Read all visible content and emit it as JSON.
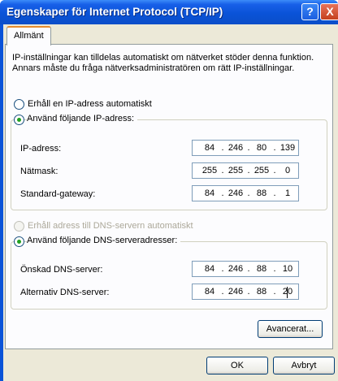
{
  "window": {
    "title": "Egenskaper för Internet Protocol (TCP/IP)",
    "help_glyph": "?",
    "close_glyph": "X"
  },
  "tab": {
    "label": "Allmänt"
  },
  "description": "IP-inställningar kan tilldelas automatiskt om nätverket stöder denna funktion. Annars måste du fråga nätverksadministratören om rätt IP-inställningar.",
  "ip_section": {
    "auto_option": "Erhåll en IP-adress automatiskt",
    "manual_option": "Använd följande IP-adress:",
    "selected": "manual",
    "fields": [
      {
        "label": "IP-adress:",
        "octets": [
          "84",
          "246",
          "80",
          "139"
        ]
      },
      {
        "label": "Nätmask:",
        "octets": [
          "255",
          "255",
          "255",
          "0"
        ]
      },
      {
        "label": "Standard-gateway:",
        "octets": [
          "84",
          "246",
          "88",
          "1"
        ]
      }
    ]
  },
  "dns_section": {
    "auto_option": "Erhåll adress till DNS-servern automatiskt",
    "auto_disabled": true,
    "manual_option": "Använd följande DNS-serveradresser:",
    "selected": "manual",
    "fields": [
      {
        "label": "Önskad DNS-server:",
        "octets": [
          "84",
          "246",
          "88",
          "10"
        ]
      },
      {
        "label": "Alternativ DNS-server:",
        "octets": [
          "84",
          "246",
          "88",
          "20"
        ]
      }
    ]
  },
  "buttons": {
    "advanced": "Avancerat...",
    "ok": "OK",
    "cancel": "Avbryt"
  },
  "colors": {
    "titlebar": "#0a53d8",
    "dialog_bg": "#ece9d8",
    "panel_bg": "#fcfcfe",
    "tab_highlight": "#e68b2c",
    "radio_dot": "#21a121"
  },
  "icons": {
    "help": "help-icon",
    "close": "close-icon"
  }
}
